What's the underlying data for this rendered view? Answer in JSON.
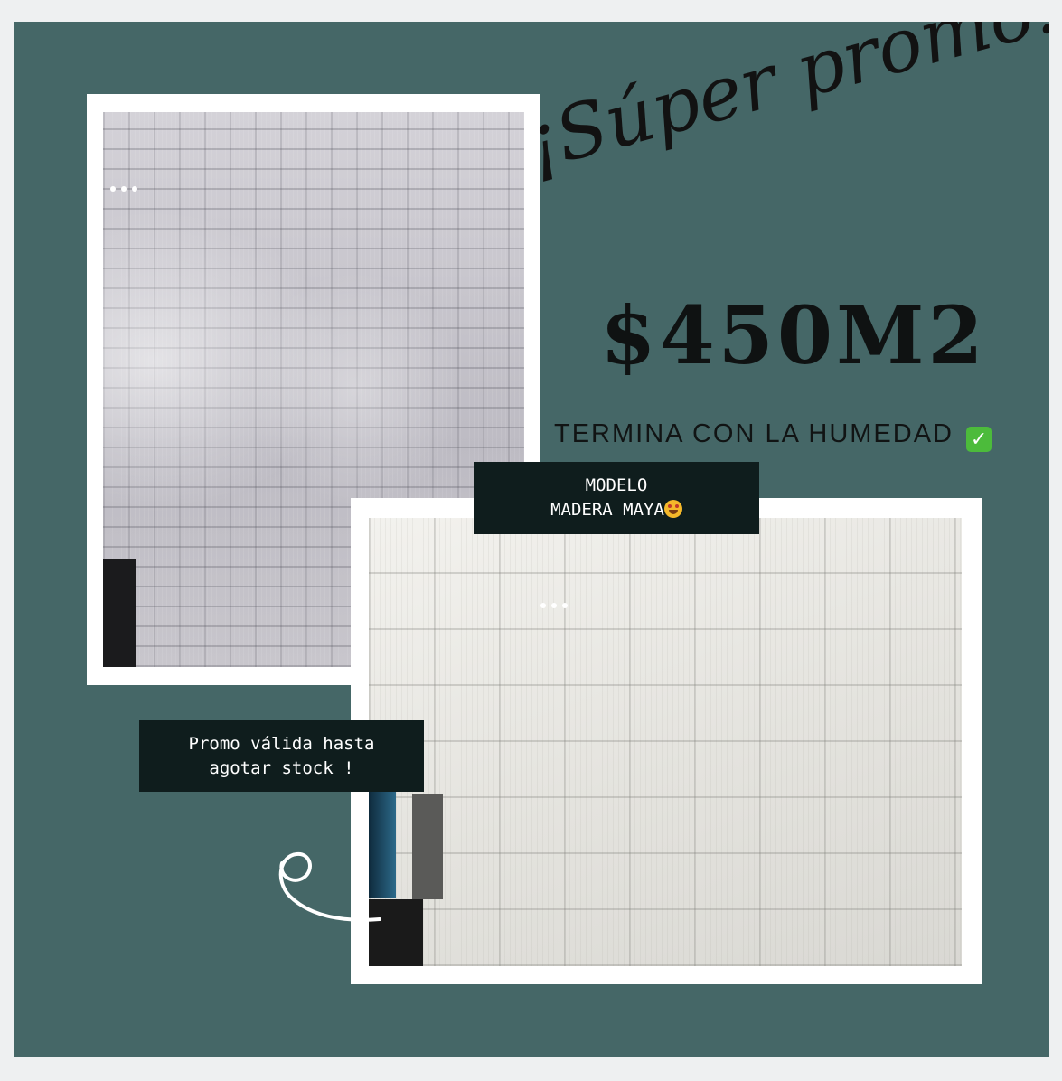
{
  "promo": {
    "headline": "¡Súper promo!",
    "price": "$450M2",
    "tagline": "TERMINA CON LA HUMEDAD",
    "tagline_icon": "check-mark-emoji",
    "model_line1": "MODELO",
    "model_line2": "MADERA MAYA",
    "model_icon": "star-struck-emoji",
    "validity_line1": "Promo válida hasta",
    "validity_line2": "agotar stock !"
  },
  "colors": {
    "background": "#456767",
    "label_bg": "#0f1d1d",
    "frame": "#ffffff",
    "text_dark": "#121212"
  }
}
